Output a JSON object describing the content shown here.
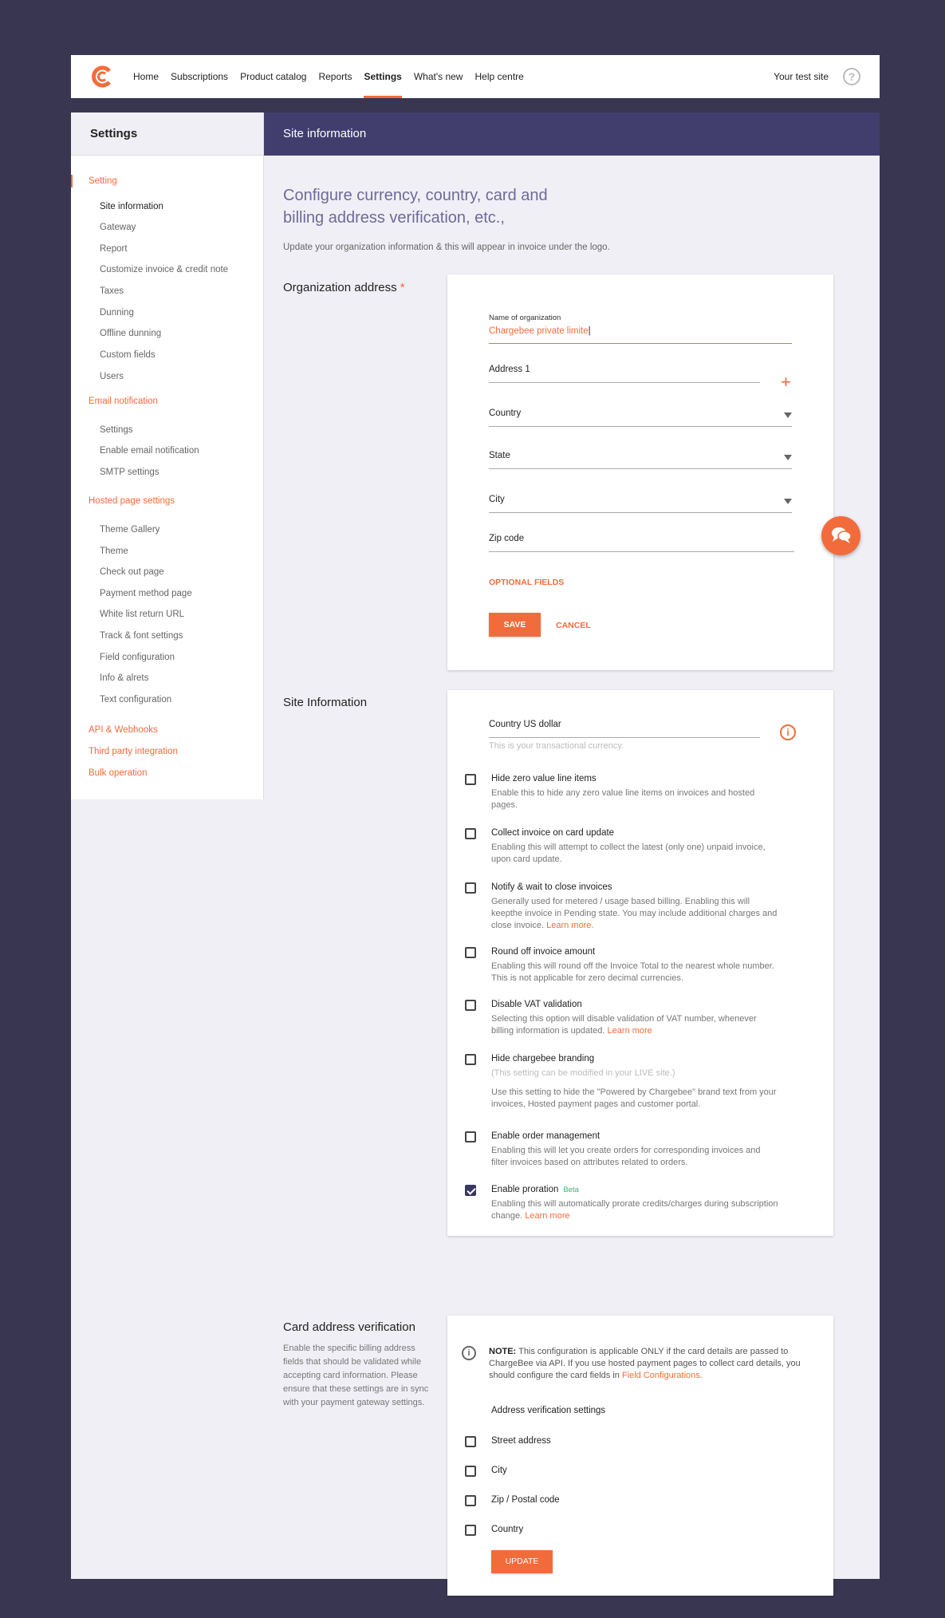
{
  "nav": {
    "links": [
      "Home",
      "Subscriptions",
      "Product catalog",
      "Reports",
      "Settings",
      "What's new",
      "Help centre"
    ],
    "active": "Settings",
    "site_name": "Your test site",
    "help_glyph": "?"
  },
  "sidebar": {
    "title": "Settings",
    "groups": [
      {
        "label": "Setting",
        "items": [
          "Site information",
          "Gateway",
          "Report",
          "Customize invoice & credit note",
          "Taxes",
          "Dunning",
          "Offline dunning",
          "Custom fields",
          "Users"
        ]
      },
      {
        "label": "Email notification",
        "items": [
          "Settings",
          "Enable email notification",
          "SMTP settings"
        ]
      },
      {
        "label": "Hosted page settings",
        "items": [
          "Theme Gallery",
          "Theme",
          "Check out page",
          "Payment method page",
          "White list return URL",
          "Track & font settings",
          "Field configuration",
          "Info & alrets",
          "Text configuration"
        ]
      },
      {
        "label": "API & Webhooks",
        "items": []
      },
      {
        "label": "Third party integration",
        "items": []
      },
      {
        "label": "Bulk operation",
        "items": []
      }
    ]
  },
  "content": {
    "header": "Site information",
    "intro_title": "Configure currency, country, card and billing address verification, etc.,",
    "intro_sub": "Update your organization information & this will appear in invoice under the logo."
  },
  "org_address": {
    "label": "Organization address",
    "required_mark": "*",
    "name_label": "Name of organization",
    "name_value": "Chargebee private limite",
    "address1": "Address 1",
    "country": "Country",
    "state": "State",
    "city": "City",
    "zip": "Zip code",
    "plus": "+",
    "optional": "OPTIONAL FIELDS",
    "save": "SAVE",
    "cancel": "CANCEL"
  },
  "site_info": {
    "label": "Site Information",
    "currency": "Country US dollar",
    "currency_hint": "This is your transactional currency.",
    "info_glyph": "i",
    "options": [
      {
        "title": "Hide zero value line items",
        "desc": "Enable this to hide any zero value line items on invoices and hosted pages.",
        "link": "",
        "checked": false
      },
      {
        "title": "Collect invoice on card update",
        "desc": "Enabling this will attempt to collect the latest (only one) unpaid invoice, upon card update.",
        "link": "",
        "checked": false
      },
      {
        "title": "Notify & wait to close invoices",
        "desc": "Generally used for metered / usage based billing. Enabling this will keepthe invoice in Pending state. You may include additional charges and close invoice.",
        "link": "Learn more.",
        "checked": false
      },
      {
        "title": "Round off invoice amount",
        "desc": "Enabling this will round off the Invoice Total to the nearest whole number. This is not applicable for zero decimal currencies.",
        "link": "",
        "checked": false
      },
      {
        "title": "Disable VAT validation",
        "desc": "Selecting this option will disable validation of VAT number, whenever billing information is updated.",
        "link": "Learn more",
        "checked": false
      },
      {
        "title": "Hide chargebee branding",
        "muted": "(This setting can be modified in your LIVE site.)",
        "desc": "Use this setting to hide the \"Powered by Chargebee\" brand text from your invoices, Hosted payment pages and customer portal.",
        "link": "",
        "checked": false
      },
      {
        "title": "Enable order management",
        "desc": "Enabling this will let you create orders for corresponding invoices and filter invoices based on attributes related to orders.",
        "link": "",
        "checked": false
      },
      {
        "title": "Enable proration",
        "badge": "Beta",
        "desc": "Enabling this will automatically prorate credits/charges during subscription change.",
        "link": "Learn more",
        "checked": true
      }
    ]
  },
  "card_verify": {
    "label": "Card address verification",
    "desc": "Enable the specific billing address fields that should be validated while accepting card information. Please ensure that these settings are in sync with your payment gateway settings.",
    "note_bold": "NOTE:",
    "note": "This configuration is applicable ONLY if the card details are passed to ChargeBee via API. If you use hosted payment pages to collect card details, you should configure the card fields in",
    "note_link": "Field Configurations.",
    "sub_head": "Address verification settings",
    "fields": [
      "Street address",
      "City",
      "Zip / Postal code",
      "Country"
    ],
    "update": "UPDATE",
    "info_glyph": "i"
  },
  "colors": {
    "accent": "#f26c3b",
    "header": "#413e6e",
    "background": "#383650"
  },
  "icons": {
    "logo": "chargebee-logo-icon",
    "help": "help-circle-icon",
    "chat": "chat-bubbles-icon",
    "info": "info-icon",
    "caret": "caret-down-icon"
  }
}
